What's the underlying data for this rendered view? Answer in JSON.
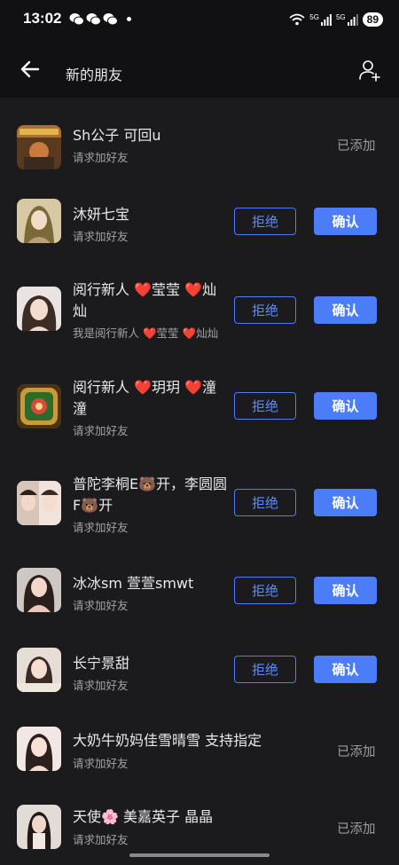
{
  "status_bar": {
    "time": "13:02",
    "signal_1": "5G",
    "signal_2": "5G",
    "battery": "89"
  },
  "header": {
    "title": "新的朋友"
  },
  "labels": {
    "reject": "拒绝",
    "confirm": "确认",
    "added": "已添加"
  },
  "requests": [
    {
      "name": "Sh公子  可回u",
      "message": "请求加好友",
      "state": "added"
    },
    {
      "name": "沐妍七宝",
      "message": "请求加好友",
      "state": "pending"
    },
    {
      "name": "阅行新人 ❤️莹莹  ❤️灿灿",
      "message": "我是阅行新人 ❤️莹莹  ❤️灿灿",
      "state": "pending"
    },
    {
      "name": "阅行新人 ❤️玥玥 ❤️潼潼",
      "message": "请求加好友",
      "state": "pending"
    },
    {
      "name": "普陀李桐E🐻开，李圆圆F🐻开",
      "message": "请求加好友",
      "state": "pending"
    },
    {
      "name": "冰冰sm  萱萱smwt",
      "message": "请求加好友",
      "state": "pending"
    },
    {
      "name": "长宁景甜",
      "message": "请求加好友",
      "state": "pending"
    },
    {
      "name": "大奶牛奶妈佳雪晴雪 支持指定",
      "message": "请求加好友",
      "state": "added"
    },
    {
      "name": "天使🌸 美嘉英子 晶晶",
      "message": "请求加好友",
      "state": "added"
    }
  ]
}
